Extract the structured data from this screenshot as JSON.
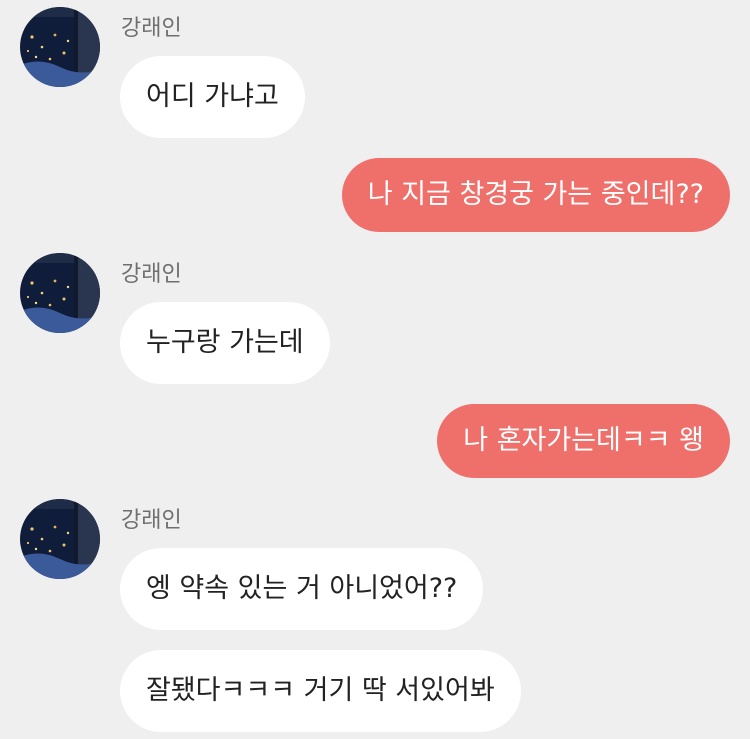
{
  "theme": {
    "background": "#efefef",
    "outgoing_bubble": "#ef706b",
    "incoming_bubble": "#ffffff"
  },
  "sender": {
    "name": "강래인",
    "avatar_icon": "night-city-photo-avatar"
  },
  "messages": [
    {
      "direction": "in",
      "text": "어디 가냐고"
    },
    {
      "direction": "out",
      "text": "나 지금 창경궁 가는 중인데??"
    },
    {
      "direction": "in",
      "text": "누구랑 가는데"
    },
    {
      "direction": "out",
      "text": "나 혼자가는데ㅋㅋ 왱"
    },
    {
      "direction": "in",
      "text": "엥 약속 있는 거 아니었어??"
    },
    {
      "direction": "in",
      "text": "잘됐다ㅋㅋㅋ 거기 딱 서있어봐"
    }
  ]
}
